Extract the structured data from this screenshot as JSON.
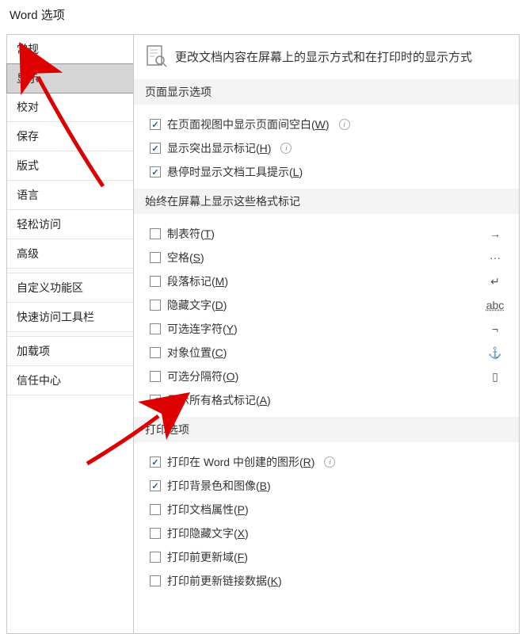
{
  "title": "Word 选项",
  "sidebar": {
    "items": [
      {
        "label": "常规"
      },
      {
        "label": "显示"
      },
      {
        "label": "校对"
      },
      {
        "label": "保存"
      },
      {
        "label": "版式"
      },
      {
        "label": "语言"
      },
      {
        "label": "轻松访问"
      },
      {
        "label": "高级"
      },
      {
        "label": "自定义功能区"
      },
      {
        "label": "快速访问工具栏"
      },
      {
        "label": "加载项"
      },
      {
        "label": "信任中心"
      }
    ]
  },
  "header": "更改文档内容在屏幕上的显示方式和在打印时的显示方式",
  "section1": {
    "title": "页面显示选项",
    "opts": [
      {
        "pre": "在页面视图中显示页面间空白(",
        "key": "W",
        "post": ")",
        "checked": true,
        "info": true
      },
      {
        "pre": "显示突出显示标记(",
        "key": "H",
        "post": ")",
        "checked": true,
        "info": true
      },
      {
        "pre": "悬停时显示文档工具提示(",
        "key": "L",
        "post": ")",
        "checked": true,
        "info": false
      }
    ]
  },
  "section2": {
    "title": "始终在屏幕上显示这些格式标记",
    "opts": [
      {
        "pre": "制表符(",
        "key": "T",
        "post": ")",
        "checked": false,
        "sym": "→"
      },
      {
        "pre": "空格(",
        "key": "S",
        "post": ")",
        "checked": false,
        "sym": "···"
      },
      {
        "pre": "段落标记(",
        "key": "M",
        "post": ")",
        "checked": false,
        "sym": "↵"
      },
      {
        "pre": "隐藏文字(",
        "key": "D",
        "post": ")",
        "checked": false,
        "sym": "abc"
      },
      {
        "pre": "可选连字符(",
        "key": "Y",
        "post": ")",
        "checked": false,
        "sym": "¬"
      },
      {
        "pre": "对象位置(",
        "key": "C",
        "post": ")",
        "checked": false,
        "sym": "⚓"
      },
      {
        "pre": "可选分隔符(",
        "key": "O",
        "post": ")",
        "checked": false,
        "sym": "▯"
      },
      {
        "pre": "显示所有格式标记(",
        "key": "A",
        "post": ")",
        "checked": true,
        "sym": ""
      }
    ]
  },
  "section3": {
    "title": "打印选项",
    "opts": [
      {
        "pre": "打印在 Word 中创建的图形(",
        "key": "R",
        "post": ")",
        "checked": true,
        "info": true
      },
      {
        "pre": "打印背景色和图像(",
        "key": "B",
        "post": ")",
        "checked": true,
        "info": false
      },
      {
        "pre": "打印文档属性(",
        "key": "P",
        "post": ")",
        "checked": false,
        "info": false
      },
      {
        "pre": "打印隐藏文字(",
        "key": "X",
        "post": ")",
        "checked": false,
        "info": false
      },
      {
        "pre": "打印前更新域(",
        "key": "F",
        "post": ")",
        "checked": false,
        "info": false
      },
      {
        "pre": "打印前更新链接数据(",
        "key": "K",
        "post": ")",
        "checked": false,
        "info": false
      }
    ]
  }
}
